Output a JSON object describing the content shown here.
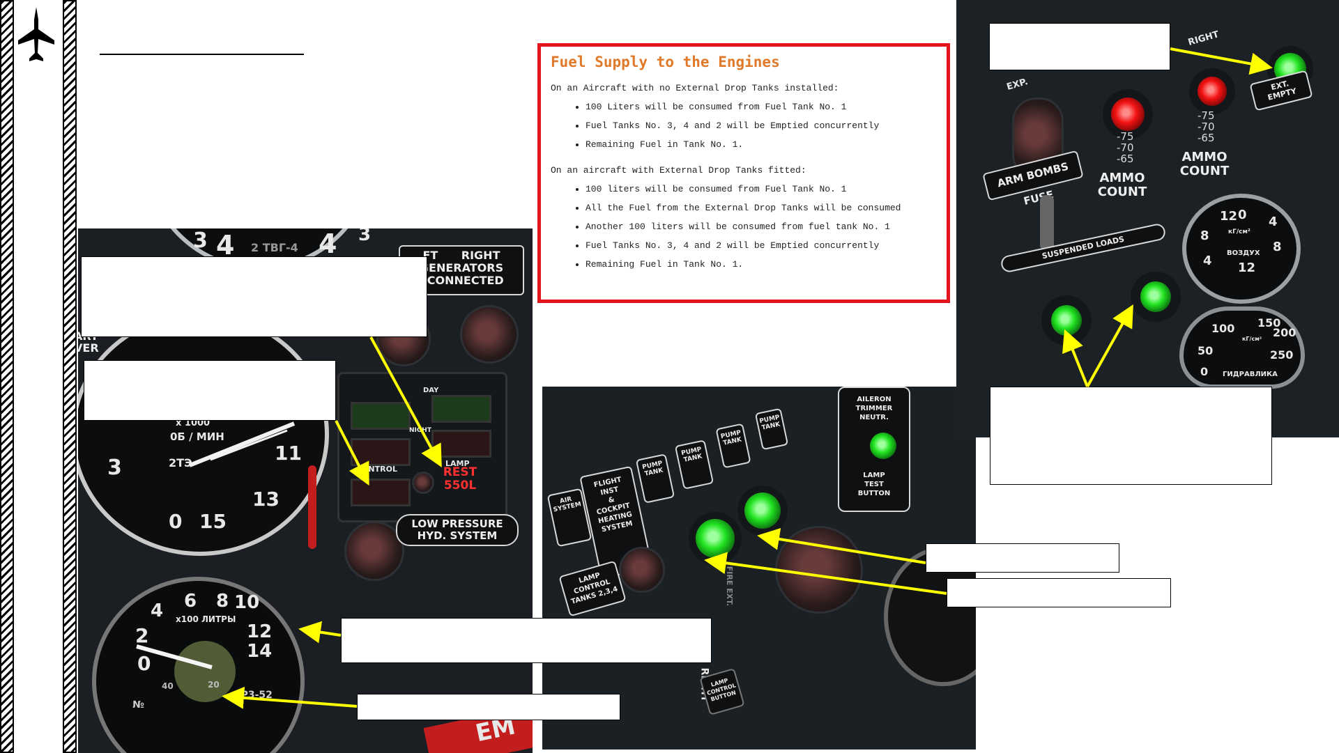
{
  "header": {
    "icon": "airplane-icon"
  },
  "info_box": {
    "title": "Fuel Supply to the Engines",
    "section1_intro": "On an Aircraft with no External Drop Tanks installed:",
    "section1_items": [
      "100 Liters will be consumed from Fuel Tank No. 1",
      "Fuel Tanks No. 3, 4 and 2 will be Emptied concurrently",
      "Remaining Fuel in Tank No. 1."
    ],
    "section2_intro": "On an aircraft with External Drop Tanks fitted:",
    "section2_items": [
      "100 liters will be consumed from Fuel Tank No. 1",
      "All the Fuel from the External Drop Tanks will be consumed",
      "Another 100 liters will be consumed from fuel tank No. 1",
      "Fuel Tanks No. 3, 4 and 2 will be Emptied concurrently",
      "Remaining Fuel in Tank No. 1."
    ]
  },
  "left_panel": {
    "gauge_top_text": "2 ТВГ-4",
    "gauge_top_nums": [
      "3",
      "4",
      "4",
      "3"
    ],
    "generators_plate": [
      "FT",
      "RIGHT",
      "GENERATORS",
      "SCONNECTED"
    ],
    "start_over": [
      "ART",
      "VER"
    ],
    "rpm_gauge": {
      "unit": "x 1000",
      "unit2": "0Б / МИН",
      "model": "2ТЭ",
      "numbers": [
        "3",
        "0",
        "15",
        "11",
        "13"
      ]
    },
    "day_label": "DAY",
    "night_label": "NIGHT",
    "control_label": "CONTROL",
    "lamp_label": "LAMP",
    "rest_label": "REST",
    "rest_value": "550L",
    "low_pressure": [
      "LOW PRESSURE",
      "HYD. SYSTEM"
    ],
    "fuel_gauge": {
      "numbers": [
        "0",
        "2",
        "4",
        "6",
        "8",
        "10",
        "12",
        "14"
      ],
      "unit": "x100 ЛИТРЫ",
      "model": "ЕР3-52",
      "small_ticks": [
        "40",
        "20"
      ],
      "serial_label": "№"
    },
    "bottom_label": "EM"
  },
  "middle_panel": {
    "aileron_plate": [
      "AILERON",
      "TRIMMER",
      "NEUTR."
    ],
    "lamp_test": [
      "LAMP",
      "TEST",
      "BUTTON"
    ],
    "lamp_control": [
      "LAMP",
      "CONTROL",
      "TANKS 2,3,4"
    ],
    "flight_plate": [
      "FLIGHT",
      "INST",
      "&",
      "COCKPIT",
      "HEATING",
      "SYSTEM"
    ],
    "switch_labels": [
      "AIR SYSTEM",
      "PUMP TANK",
      "PUMP TANK",
      "PUMP TANK",
      "PUMP TANK"
    ],
    "right_label": "RIGHT",
    "fire_label": "FIRE EXT.",
    "lamp_control_button": [
      "LAMP",
      "CONTROL",
      "BUTTON"
    ]
  },
  "right_panel": {
    "exp_label": "EXP.",
    "right_label": "RIGHT",
    "ext_label": "EXT.",
    "empty_label": "EMPTY",
    "arm_bombs": "ARM BOMBS FUSE",
    "ammo_count_1": [
      "AMMO",
      "COUNT"
    ],
    "ammo_count_2": [
      "AMMO",
      "COUNT"
    ],
    "ammo_scale": [
      "-75",
      "-70",
      "-65"
    ],
    "suspended_loads": "SUSPENDED LOADS",
    "air_gauge": {
      "numbers": [
        "12",
        "0",
        "4",
        "8",
        "4",
        "8",
        "12"
      ],
      "unit": "кГ/см²",
      "label": "ВОЗДУХ"
    },
    "hyd_gauge": {
      "numbers": [
        "100",
        "150",
        "200",
        "250",
        "50",
        "0"
      ],
      "unit": "кГ/см²",
      "label": "ГИДРАВЛИКА"
    }
  },
  "colors": {
    "callout_arrow": "#ffff00",
    "infobox_border": "#e3141b",
    "infobox_title": "#e07a2a",
    "lamp_green": "#21e321",
    "lamp_red": "#f21212"
  }
}
